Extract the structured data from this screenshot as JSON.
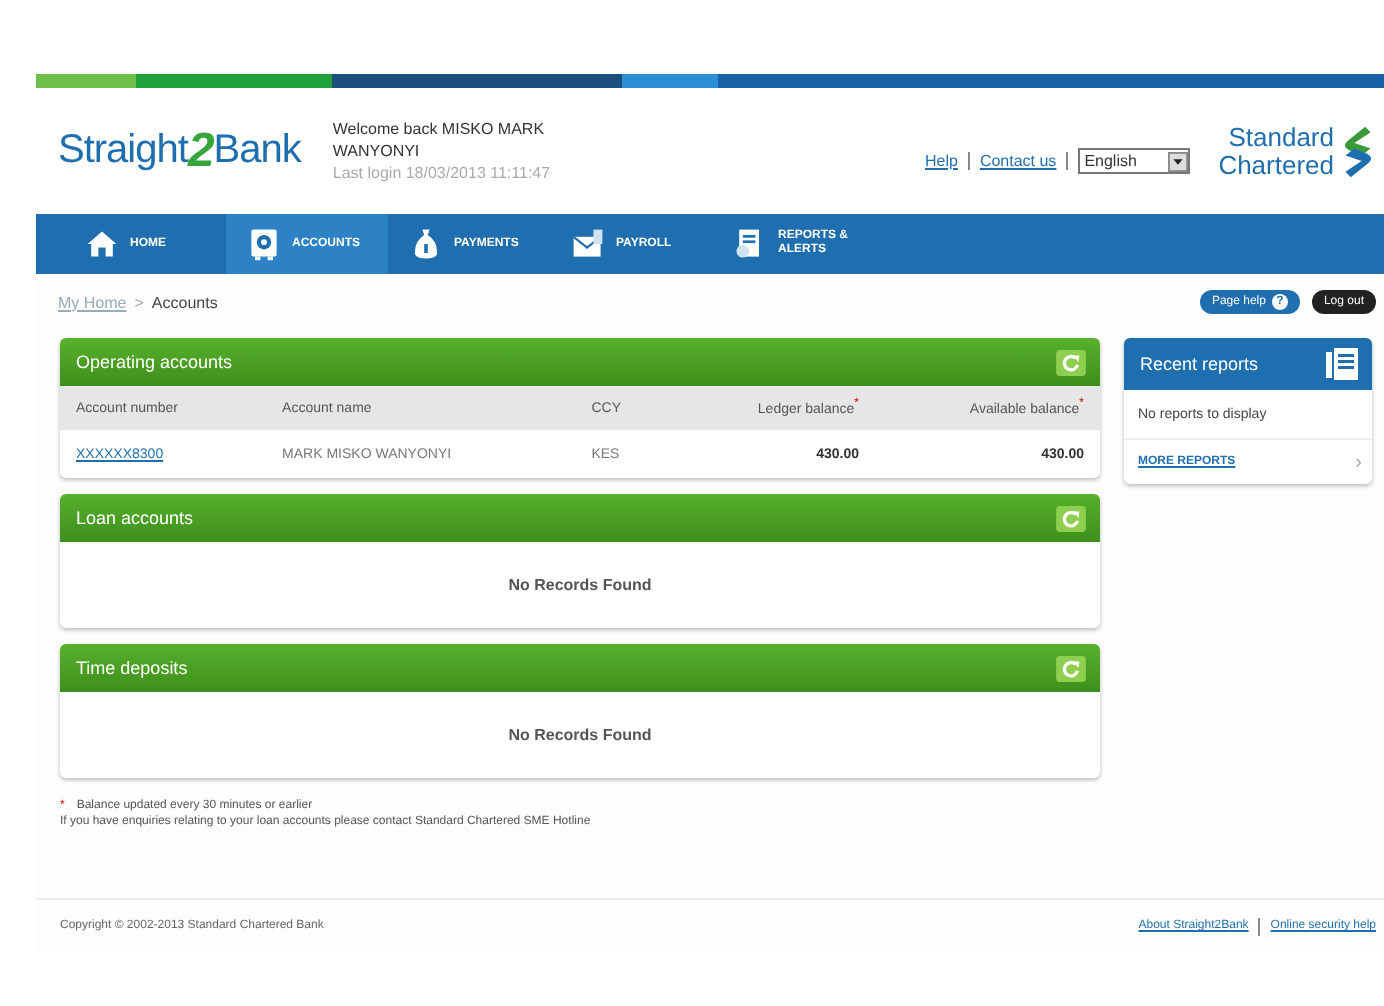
{
  "logo": {
    "lead": "Straight",
    "mark": "2",
    "tail": "Bank"
  },
  "welcome": {
    "greeting": "Welcome back MISKO MARK WANYONYI",
    "last_login": "Last login 18/03/2013 11:11:47"
  },
  "top_links": [
    {
      "label": "Help"
    },
    {
      "label": "Contact us"
    }
  ],
  "language": {
    "value": "English"
  },
  "brand": {
    "line1": "Standard",
    "line2": "Chartered"
  },
  "nav": [
    {
      "label": "HOME",
      "selected": false
    },
    {
      "label": "ACCOUNTS",
      "selected": true
    },
    {
      "label": "PAYMENTS",
      "selected": false
    },
    {
      "label": "PAYROLL",
      "selected": false
    },
    {
      "label": "REPORTS & ALERTS",
      "selected": false
    }
  ],
  "breadcrumb": [
    {
      "label": "My Home",
      "link": true
    },
    {
      "label": "Accounts",
      "link": false
    }
  ],
  "breadcrumb_separator": ">",
  "page_buttons": [
    {
      "label": "Page help",
      "kind": "help",
      "badge": "?"
    },
    {
      "label": "Log out",
      "kind": "logout"
    }
  ],
  "panels": [
    {
      "title": "Operating accounts",
      "kind": "table",
      "columns": [
        {
          "label": "Account number",
          "kind": "link"
        },
        {
          "label": "Account name",
          "kind": "text"
        },
        {
          "label": "CCY",
          "kind": "text"
        },
        {
          "label": "Ledger balance",
          "kind": "amount",
          "mark": "*"
        },
        {
          "label": "Available balance",
          "kind": "amount",
          "mark": "*"
        }
      ],
      "rows": [
        [
          "XXXXXX8300",
          "MARK MISKO WANYONYI",
          "KES",
          "430.00",
          "430.00"
        ]
      ]
    },
    {
      "title": "Loan accounts",
      "kind": "empty",
      "message": "No Records Found"
    },
    {
      "title": "Time deposits",
      "kind": "empty",
      "message": "No Records Found"
    }
  ],
  "notes": [
    {
      "mark": "*",
      "text": "Balance updated every 30 minutes or earlier"
    },
    {
      "text": "If you have enquiries relating to your loan accounts please contact Standard Chartered SME Hotline"
    }
  ],
  "recent_reports": {
    "title": "Recent reports",
    "message": "No reports to display",
    "link": "MORE REPORTS",
    "chevron": "›"
  },
  "footer": {
    "copyright": "Copyright © 2002-2013 Standard Chartered Bank",
    "links": [
      {
        "label": "About Straight2Bank"
      },
      {
        "label": "Online security help"
      }
    ]
  }
}
